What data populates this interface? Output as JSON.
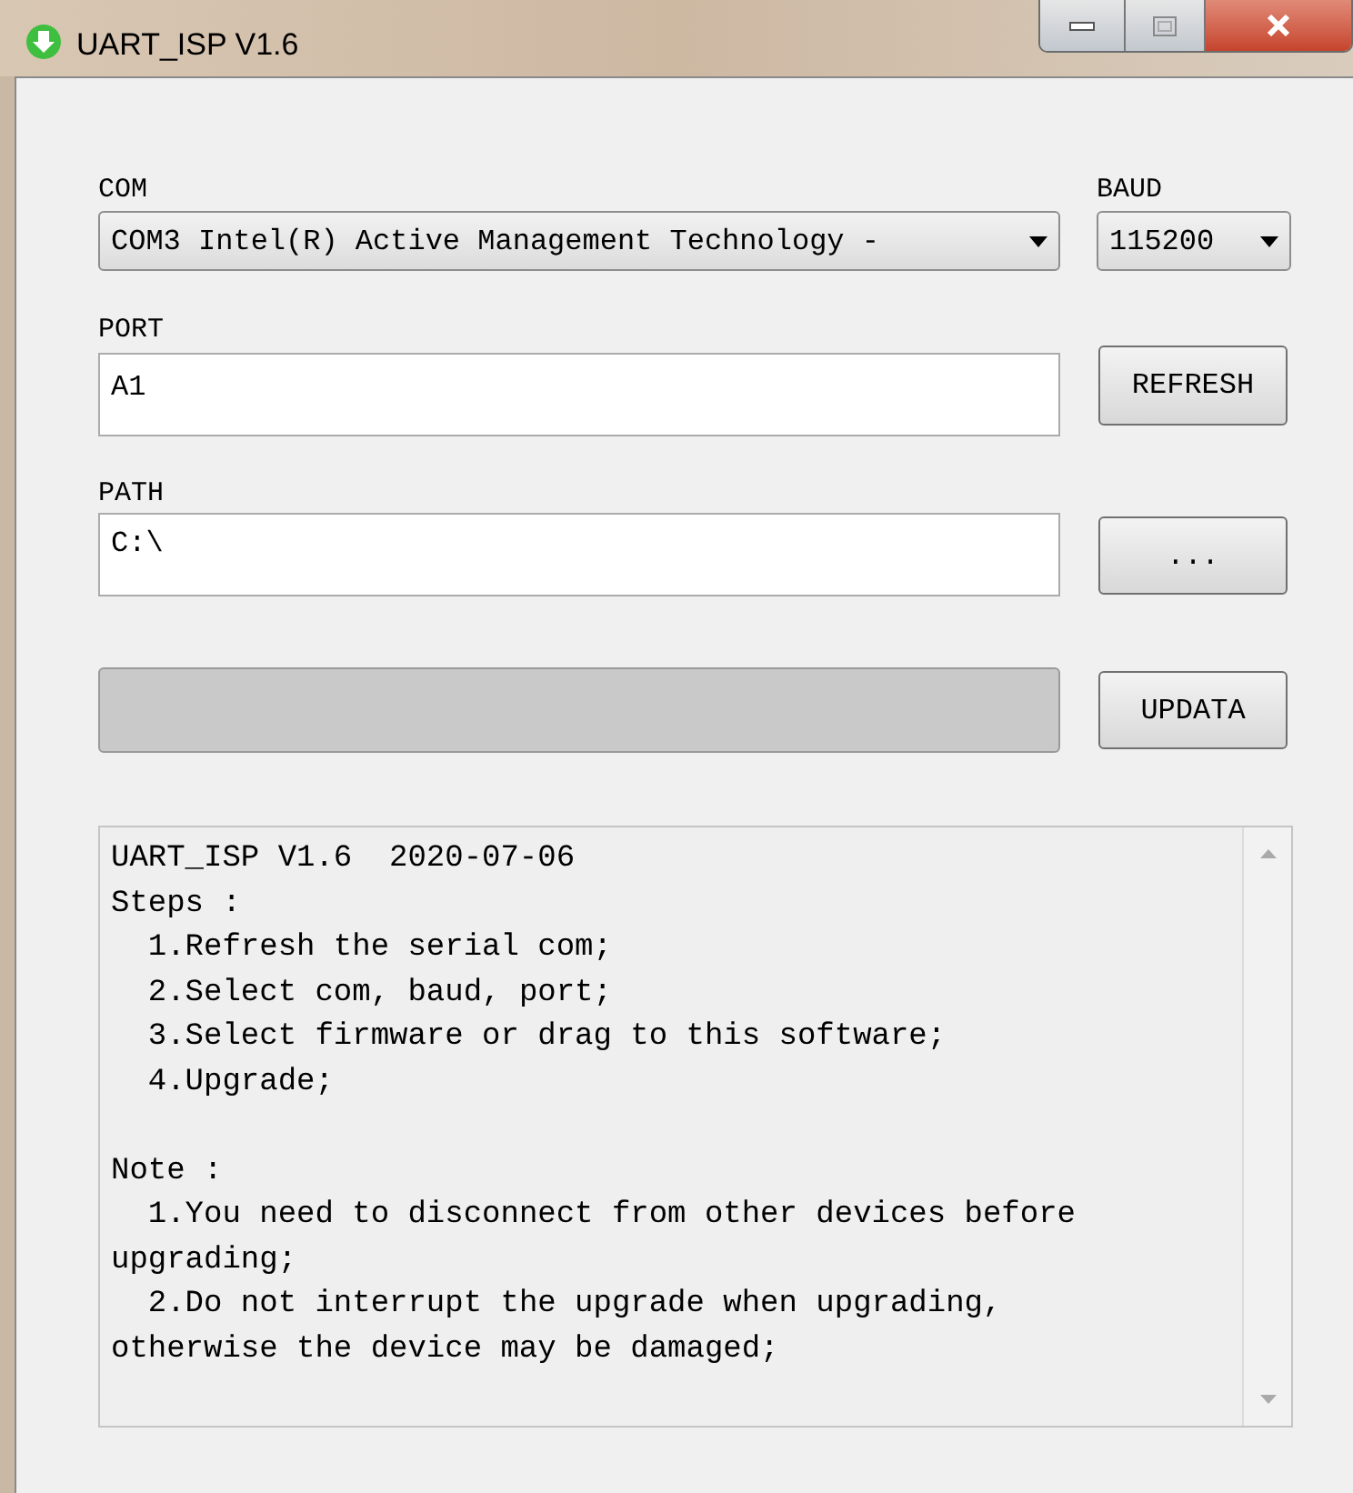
{
  "window": {
    "title": "UART_ISP V1.6"
  },
  "com": {
    "label": "COM",
    "value": "COM3 Intel(R) Active Management Technology -"
  },
  "baud": {
    "label": "BAUD",
    "value": "115200"
  },
  "port": {
    "label": "PORT",
    "value": "A1"
  },
  "refresh_button": "REFRESH",
  "path": {
    "label": "PATH",
    "value": "C:\\"
  },
  "browse_button": "...",
  "progress": {
    "level": 0
  },
  "update_button": "UPDATA",
  "log": {
    "groups": [
      [
        "UART_ISP V1.6  2020-07-06",
        "Steps :",
        "  1.Refresh the serial com;",
        "  2.Select com, baud, port;",
        "  3.Select firmware or drag to this software;",
        "  4.Upgrade;"
      ],
      [
        "Note :",
        "  1.You need to disconnect from other devices before upgrading;",
        "  2.Do not interrupt the upgrade when upgrading, otherwise the device may be damaged;"
      ]
    ]
  }
}
